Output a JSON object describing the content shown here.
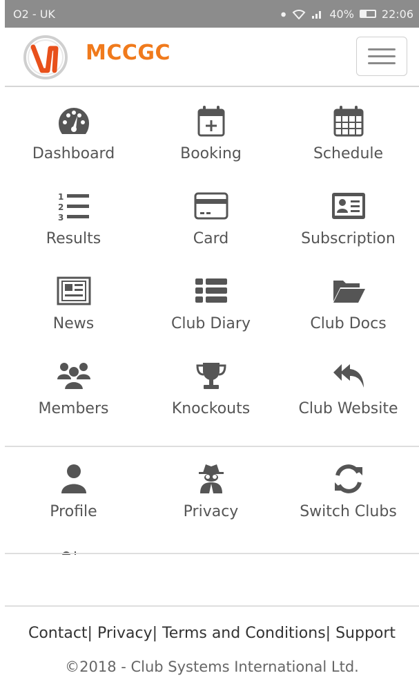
{
  "status_bar": {
    "carrier": "O2 - UK",
    "icons": [
      "vibrate-icon",
      "wifi-icon",
      "signal-icon"
    ],
    "battery_percent": "40%",
    "time": "22:06"
  },
  "header": {
    "brand": "MCCGC",
    "logo_icon": "mccgc-logo-icon",
    "menu_icon": "hamburger-icon",
    "brand_color": "#f07a1c"
  },
  "main_menu": [
    {
      "label": "Dashboard",
      "icon": "dashboard-icon"
    },
    {
      "label": "Booking",
      "icon": "calendar-plus-icon"
    },
    {
      "label": "Schedule",
      "icon": "calendar-icon"
    },
    {
      "label": "Results",
      "icon": "ordered-list-icon"
    },
    {
      "label": "Card",
      "icon": "credit-card-icon"
    },
    {
      "label": "Subscription",
      "icon": "id-card-icon"
    },
    {
      "label": "News",
      "icon": "newspaper-icon"
    },
    {
      "label": "Club Diary",
      "icon": "list-icon"
    },
    {
      "label": "Club Docs",
      "icon": "folder-open-icon"
    },
    {
      "label": "Members",
      "icon": "users-icon"
    },
    {
      "label": "Knockouts",
      "icon": "trophy-icon"
    },
    {
      "label": "Club Website",
      "icon": "reply-all-icon"
    }
  ],
  "account_menu": [
    {
      "label": "Profile",
      "icon": "user-icon"
    },
    {
      "label": "Privacy",
      "icon": "user-secret-icon"
    },
    {
      "label": "Switch Clubs",
      "icon": "refresh-icon"
    }
  ],
  "footer": {
    "links": [
      "Contact",
      "Privacy",
      "Terms and Conditions",
      "Support"
    ],
    "separator": "|",
    "copyright": "©2018 - Club Systems International Ltd."
  },
  "colors": {
    "icon": "#555555",
    "accent": "#f07a1c",
    "status_bar": "#8c8c8c"
  }
}
